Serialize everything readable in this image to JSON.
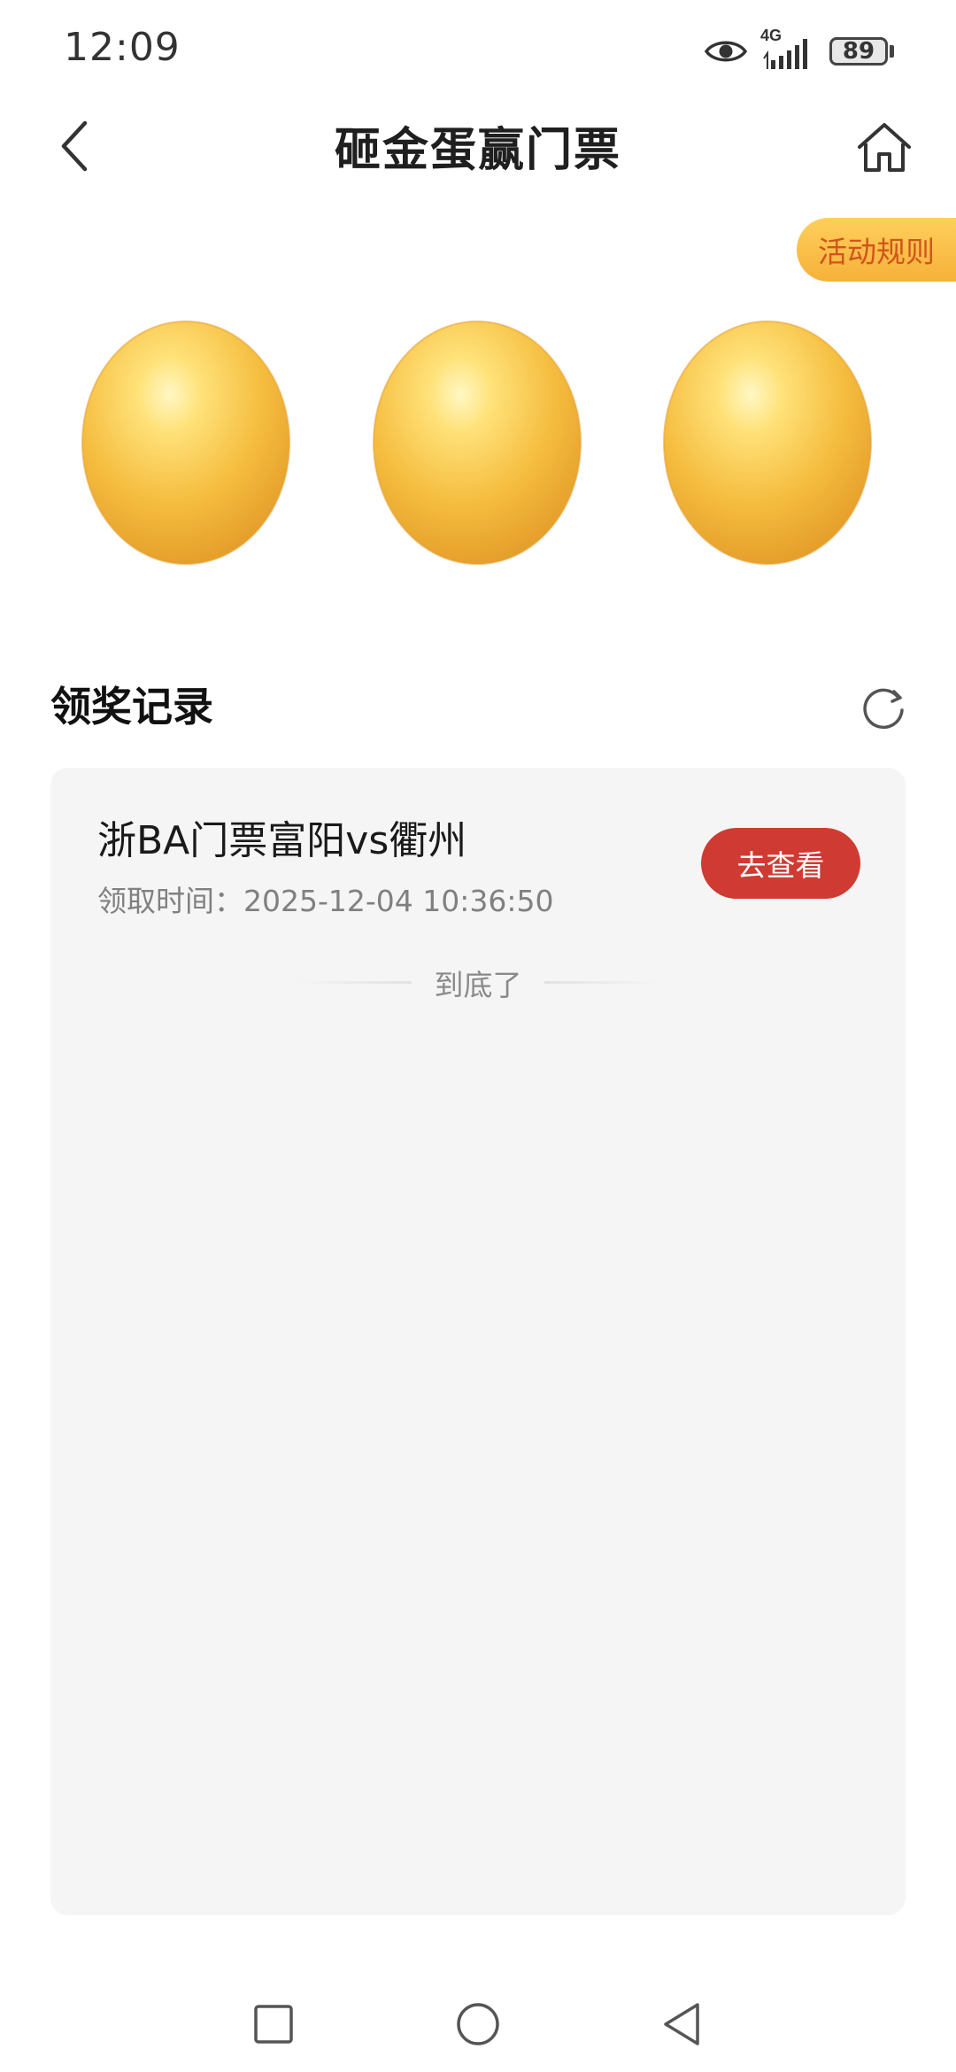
{
  "status_bar": {
    "time": "12:09",
    "network": "4G",
    "battery": "89",
    "icons": [
      "eye-icon",
      "signal-icon",
      "battery-icon"
    ]
  },
  "header": {
    "title": "砸金蛋赢门票",
    "back_icon": "chevron-left-icon",
    "home_icon": "home-icon"
  },
  "rules_button": {
    "label": "活动规则",
    "color": "#f6b13a",
    "text_color": "#d0541d"
  },
  "eggs": [
    {
      "icon": "golden-egg-icon"
    },
    {
      "icon": "golden-egg-icon"
    },
    {
      "icon": "golden-egg-icon"
    }
  ],
  "records": {
    "title": "领奖记录",
    "refresh_icon": "refresh-icon",
    "items": [
      {
        "title": "浙BA门票富阳vs衢州",
        "time_label": "领取时间：",
        "time_value": "2025-12-04 10:36:50",
        "action_label": "去查看"
      }
    ],
    "end_text": "到底了"
  },
  "colors": {
    "accent": "#cf3b32",
    "card_bg": "#f5f5f5",
    "egg_gold": "#f2b333"
  },
  "nav_bar": {
    "icons": [
      "recent-apps-icon",
      "home-circle-icon",
      "back-triangle-icon"
    ]
  }
}
